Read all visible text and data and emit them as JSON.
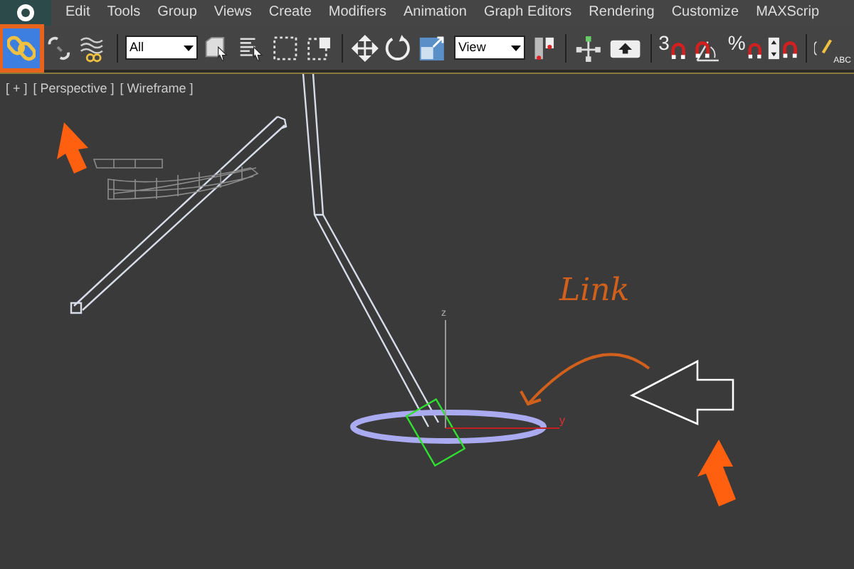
{
  "menu": [
    {
      "label": "Edit"
    },
    {
      "label": "Tools"
    },
    {
      "label": "Group"
    },
    {
      "label": "Views"
    },
    {
      "label": "Create"
    },
    {
      "label": "Modifiers"
    },
    {
      "label": "Animation"
    },
    {
      "label": "Graph Editors"
    },
    {
      "label": "Rendering"
    },
    {
      "label": "Customize"
    },
    {
      "label": "MAXScrip"
    }
  ],
  "toolbar": {
    "link_tool": {
      "selected": true,
      "highlighted": true
    },
    "selection_filter": {
      "value": "All"
    },
    "reference_coordinate": {
      "value": "View"
    },
    "snaps_toggle": {
      "label": "3"
    },
    "percent_snap": {
      "label": "%"
    },
    "named_selection": {
      "label": "ABC"
    }
  },
  "viewport": {
    "labels": [
      "[ + ]",
      "[ Perspective ]",
      "[ Wireframe ]"
    ],
    "annotation": "Link",
    "axis_labels": [
      "z",
      "y"
    ]
  }
}
